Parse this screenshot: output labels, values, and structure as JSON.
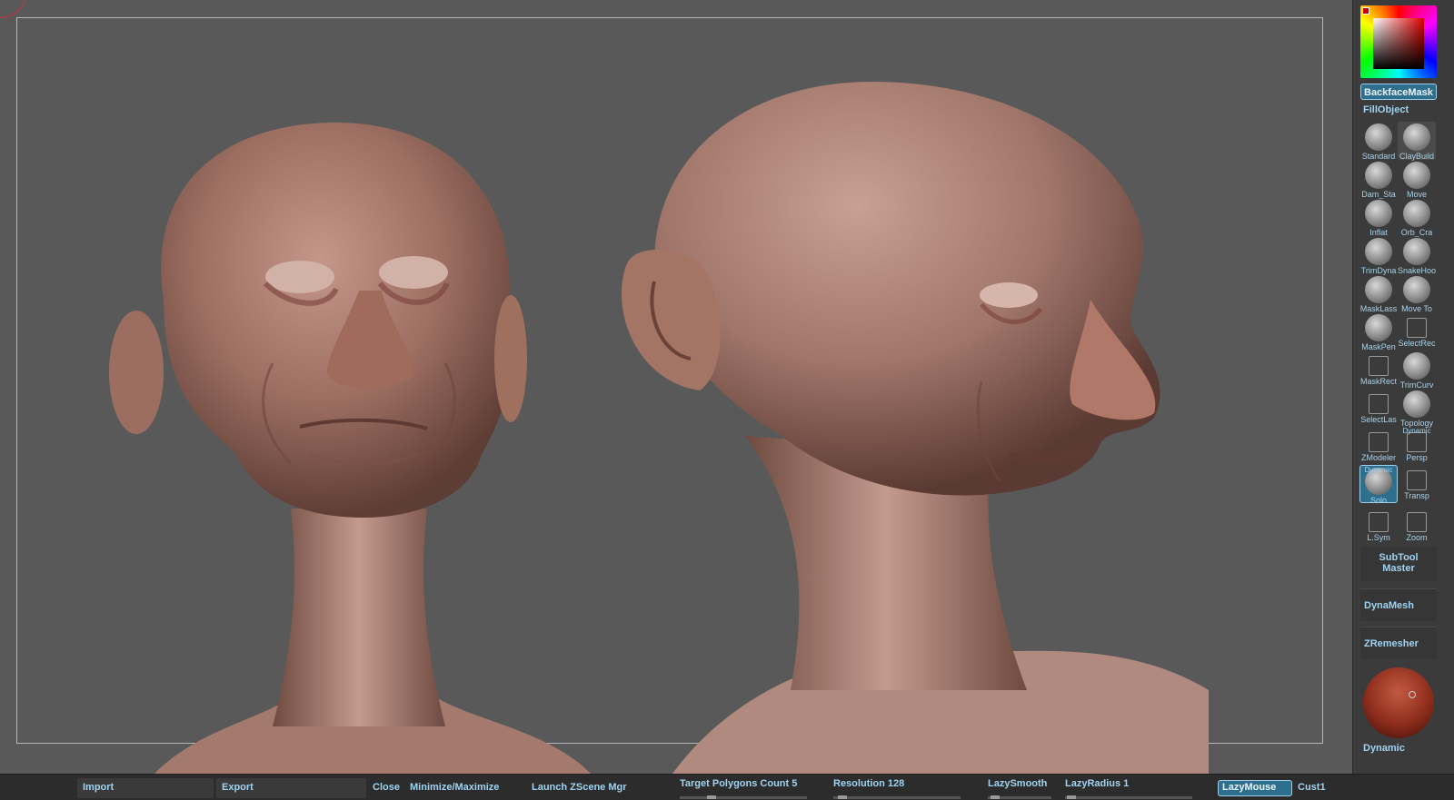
{
  "shelf": {
    "backface_mask": "BackfaceMask",
    "fill_object": "FillObject",
    "brushes": [
      {
        "label": "Standard"
      },
      {
        "label": "ClayBuild"
      },
      {
        "label": "Dam_Sta"
      },
      {
        "label": "Move"
      },
      {
        "label": "Inflat"
      },
      {
        "label": "Orb_Cra"
      },
      {
        "label": "TrimDyna"
      },
      {
        "label": "SnakeHoo"
      },
      {
        "label": "MaskLass"
      },
      {
        "label": "Move To"
      },
      {
        "label": "MaskPen"
      },
      {
        "label": "SelectRec"
      },
      {
        "label": "MaskRect"
      },
      {
        "label": "TrimCurv"
      },
      {
        "label": "SelectLas"
      },
      {
        "label": "Topology"
      },
      {
        "label": "ZModeler"
      },
      {
        "label": "Persp",
        "badge": "Dynamic"
      },
      {
        "label": "Solo",
        "badge": "Dynamic"
      },
      {
        "label": "Transp"
      },
      {
        "label": "L.Sym"
      },
      {
        "label": "Zoom"
      }
    ],
    "subtool_master_line1": "SubTool",
    "subtool_master_line2": "Master",
    "dynamesh": "DynaMesh",
    "zremesher": "ZRemesher",
    "dynamic": "Dynamic",
    "material_color": "#8e2d1c"
  },
  "bottombar": {
    "import": "Import",
    "export": "Export",
    "close": "Close",
    "minmax": "Minimize/Maximize",
    "launch": "Launch ZScene Mgr",
    "target_polygons": "Target Polygons Count 5",
    "resolution": "Resolution 128",
    "lazysmooth": "LazySmooth",
    "lazyradius": "LazyRadius 1",
    "lazymouse": "LazyMouse",
    "cust1": "Cust1"
  }
}
